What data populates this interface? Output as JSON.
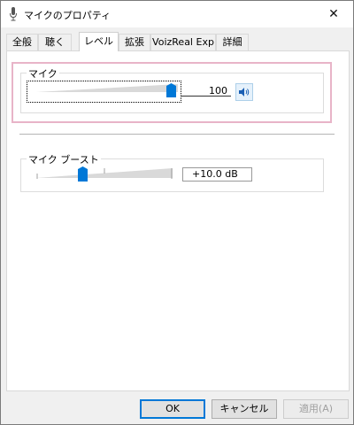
{
  "window": {
    "title": "マイクのプロパティ",
    "close_glyph": "✕"
  },
  "tabs": [
    {
      "label": "全般"
    },
    {
      "label": "聴く"
    },
    {
      "label": "レベル"
    },
    {
      "label": "拡張"
    },
    {
      "label": "VoizReal Exp"
    },
    {
      "label": "詳細"
    }
  ],
  "active_tab": "レベル",
  "mic_group": {
    "title": "マイク",
    "level_value": "100",
    "level_fraction": 1.0,
    "mute_icon": "speaker-icon"
  },
  "boost_group": {
    "title": "マイク ブースト",
    "value_label": "+10.0 dB",
    "boost_fraction": 0.33
  },
  "buttons": {
    "ok": "OK",
    "cancel": "キャンセル",
    "apply": "適用(A)"
  },
  "colors": {
    "accent": "#0078d7",
    "highlight_frame": "#e8b4c8"
  }
}
